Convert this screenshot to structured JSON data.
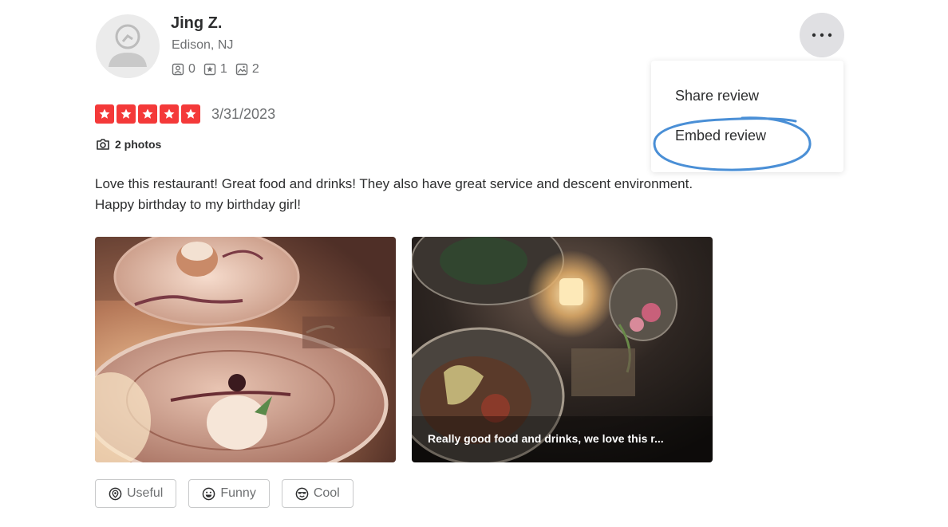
{
  "user": {
    "name": "Jing Z.",
    "location": "Edison, NJ",
    "stats": {
      "friends": "0",
      "reviews": "1",
      "photos": "2"
    }
  },
  "menu": {
    "share_label": "Share review",
    "embed_label": "Embed review"
  },
  "review": {
    "rating": 5,
    "date": "3/31/2023",
    "photo_count_label": "2 photos",
    "text_line1": "Love this restaurant! Great food and drinks! They also have great service and descent environment.",
    "text_line2": "Happy birthday to my birthday girl!"
  },
  "photos": [
    {
      "caption": ""
    },
    {
      "caption": "Really good food and drinks, we love this r..."
    }
  ],
  "reactions": {
    "useful_label": "Useful",
    "funny_label": "Funny",
    "cool_label": "Cool"
  },
  "colors": {
    "star_red": "#f43939",
    "annotation_blue": "#4a8fd6",
    "text_gray": "#6e7072"
  },
  "icons": {
    "avatar": "default-user-avatar-icon",
    "friends": "friends-icon",
    "reviews": "review-star-icon",
    "photos": "photo-icon",
    "camera": "camera-icon",
    "more": "more-horizontal-icon",
    "useful": "useful-icon",
    "funny": "funny-icon",
    "cool": "cool-icon"
  }
}
